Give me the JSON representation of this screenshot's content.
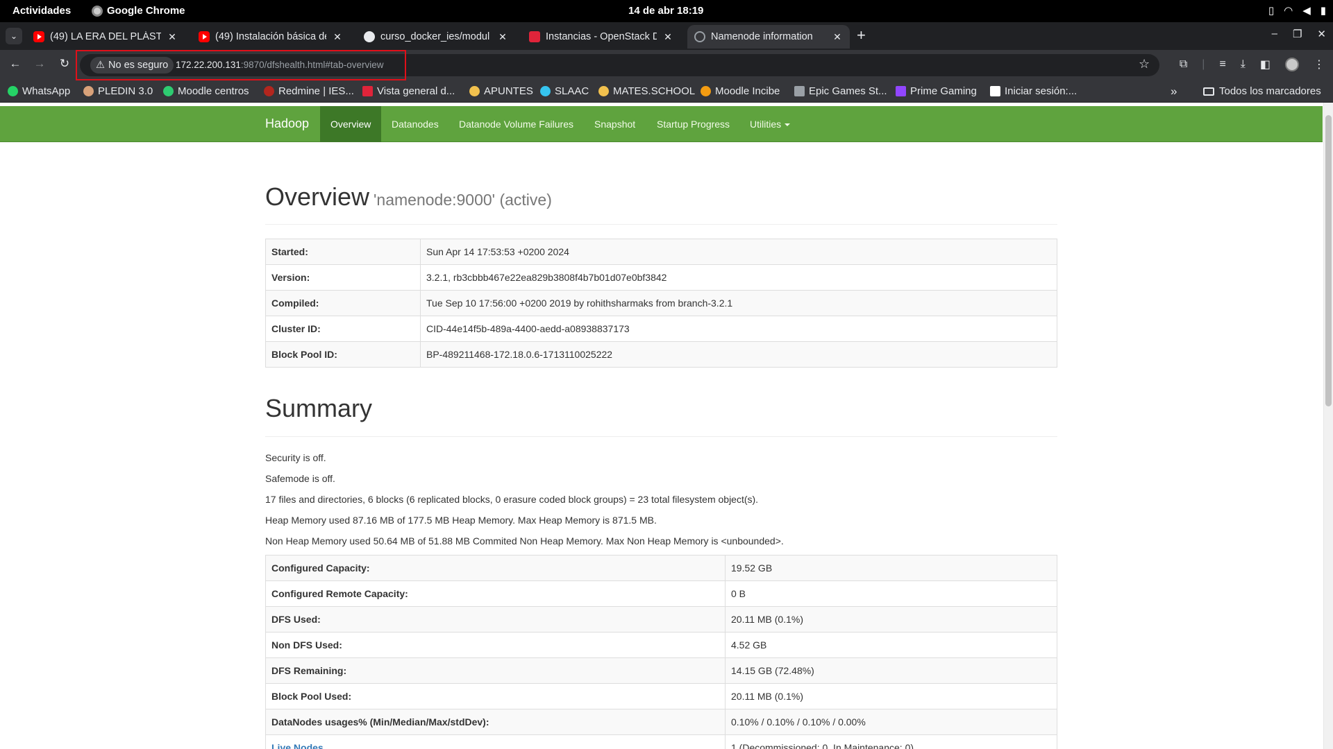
{
  "system": {
    "activities": "Actividades",
    "app_name": "Google Chrome",
    "clock": "14 de abr  18:19"
  },
  "tabs": [
    {
      "title": "(49) LA ERA DEL PLÁSTIC",
      "favicon": "youtube-icon",
      "active": false
    },
    {
      "title": "(49) Instalación básica de",
      "favicon": "youtube-icon",
      "active": false
    },
    {
      "title": "curso_docker_ies/modul",
      "favicon": "github-icon",
      "active": false
    },
    {
      "title": "Instancias - OpenStack D",
      "favicon": "openstack-icon",
      "active": false
    },
    {
      "title": "Namenode information",
      "favicon": "globe-icon",
      "active": true
    }
  ],
  "toolbar": {
    "security_label": "No es seguro",
    "url_host": "172.22.200.131",
    "url_rest": ":9870/dfshealth.html#tab-overview"
  },
  "bookmarks": [
    {
      "label": "WhatsApp",
      "color": "#25d366"
    },
    {
      "label": "PLEDIN 3.0",
      "color": "#d9a27a"
    },
    {
      "label": "Moodle centros",
      "color": "#2ecc71"
    },
    {
      "label": "Redmine | IES...",
      "color": "#b3261e"
    },
    {
      "label": "Vista general d...",
      "color": "#e0243a"
    },
    {
      "label": "APUNTES",
      "color": "#f2c14e"
    },
    {
      "label": "SLAAC",
      "color": "#36c5f0"
    },
    {
      "label": "MATES.SCHOOL",
      "color": "#f2c14e"
    },
    {
      "label": "Moodle Incibe",
      "color": "#f39c12"
    },
    {
      "label": "Epic Games St...",
      "color": "#9aa0a6"
    },
    {
      "label": "Prime Gaming",
      "color": "#9146ff"
    },
    {
      "label": "Iniciar sesión:...",
      "color": "#ffffff"
    }
  ],
  "bookmarks_all": "Todos los marcadores",
  "hadoop_nav": {
    "brand": "Hadoop",
    "items": [
      "Overview",
      "Datanodes",
      "Datanode Volume Failures",
      "Snapshot",
      "Startup Progress",
      "Utilities"
    ]
  },
  "overview": {
    "title": "Overview",
    "subtitle": "'namenode:9000' (active)",
    "rows": [
      {
        "key": "Started:",
        "value": "Sun Apr 14 17:53:53 +0200 2024"
      },
      {
        "key": "Version:",
        "value": "3.2.1, rb3cbbb467e22ea829b3808f4b7b01d07e0bf3842"
      },
      {
        "key": "Compiled:",
        "value": "Tue Sep 10 17:56:00 +0200 2019 by rohithsharmaks from branch-3.2.1"
      },
      {
        "key": "Cluster ID:",
        "value": "CID-44e14f5b-489a-4400-aedd-a08938837173"
      },
      {
        "key": "Block Pool ID:",
        "value": "BP-489211468-172.18.0.6-1713110025222"
      }
    ]
  },
  "summary": {
    "title": "Summary",
    "lines": [
      "Security is off.",
      "Safemode is off.",
      "17 files and directories, 6 blocks (6 replicated blocks, 0 erasure coded block groups) = 23 total filesystem object(s).",
      "Heap Memory used 87.16 MB of 177.5 MB Heap Memory. Max Heap Memory is 871.5 MB.",
      "Non Heap Memory used 50.64 MB of 51.88 MB Commited Non Heap Memory. Max Non Heap Memory is <unbounded>."
    ],
    "rows": [
      {
        "key": "Configured Capacity:",
        "value": "19.52 GB"
      },
      {
        "key": "Configured Remote Capacity:",
        "value": "0 B"
      },
      {
        "key": "DFS Used:",
        "value": "20.11 MB (0.1%)"
      },
      {
        "key": "Non DFS Used:",
        "value": "4.52 GB"
      },
      {
        "key": "DFS Remaining:",
        "value": "14.15 GB (72.48%)"
      },
      {
        "key": "Block Pool Used:",
        "value": "20.11 MB (0.1%)"
      },
      {
        "key": "DataNodes usages% (Min/Median/Max/stdDev):",
        "value": "0.10% / 0.10% / 0.10% / 0.00%"
      }
    ],
    "live_nodes_label": "Live Nodes",
    "live_nodes_value": "1 (Decommissioned: 0, In Maintenance: 0)"
  }
}
